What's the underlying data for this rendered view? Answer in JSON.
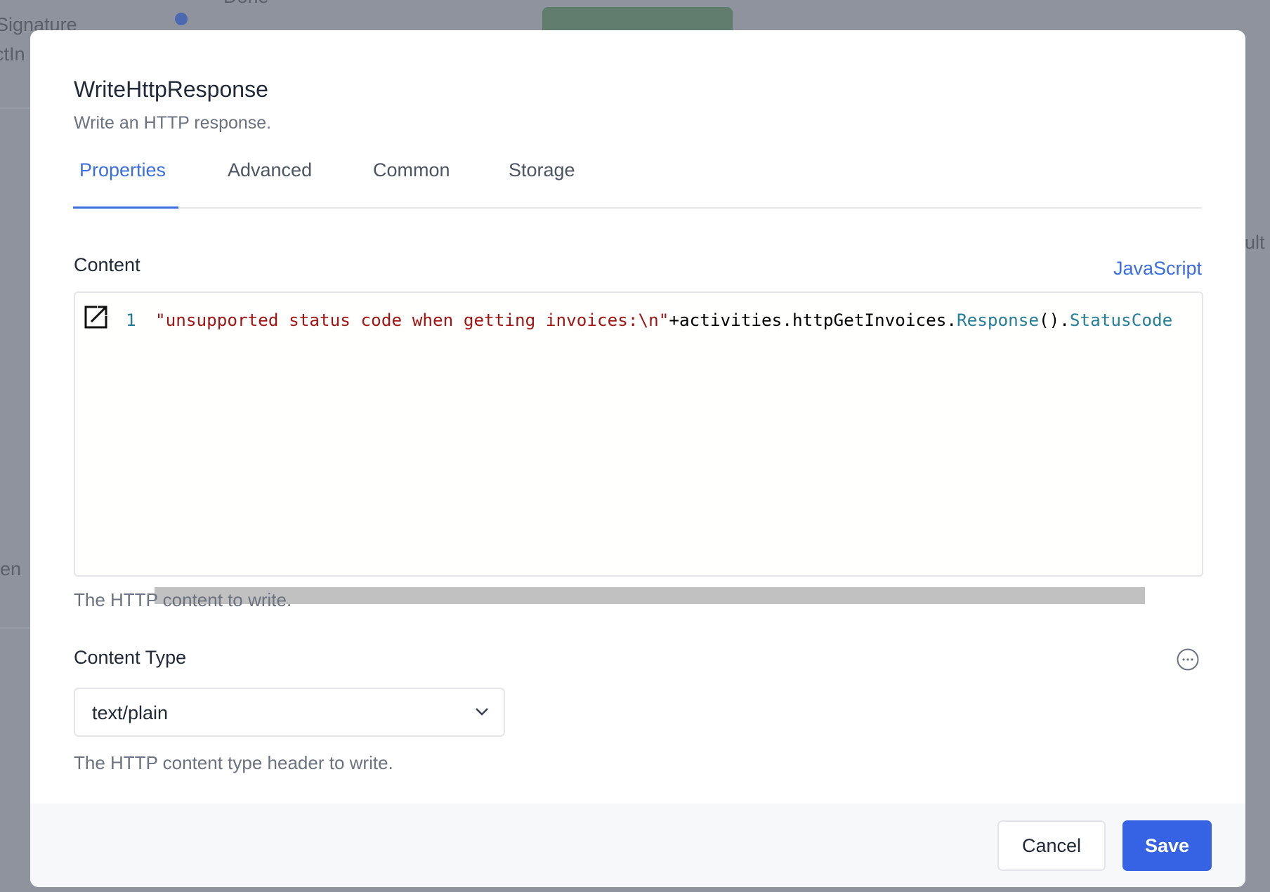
{
  "background": {
    "fragments": [
      "Signature",
      "ctIn",
      "en",
      "ult",
      "Done"
    ]
  },
  "dialog": {
    "title": "WriteHttpResponse",
    "subtitle": "Write an HTTP response.",
    "tabs": [
      {
        "label": "Properties",
        "active": true
      },
      {
        "label": "Advanced"
      },
      {
        "label": "Common"
      },
      {
        "label": "Storage"
      }
    ],
    "content": {
      "label": "Content",
      "syntax": "JavaScript",
      "line_number": "1",
      "code_string": "\"unsupported status code when getting invoices:\\n\"",
      "code_plain": "+activities.httpGetInvoices.",
      "code_method": "Response",
      "code_parens": "().",
      "code_prop": "StatusCode",
      "help": "The HTTP content to write."
    },
    "content_type": {
      "label": "Content Type",
      "value": "text/plain",
      "help": "The HTTP content type header to write."
    },
    "footer": {
      "cancel": "Cancel",
      "save": "Save"
    },
    "colors": {
      "accent": "#3b6ee0",
      "save": "#3563e3"
    }
  }
}
